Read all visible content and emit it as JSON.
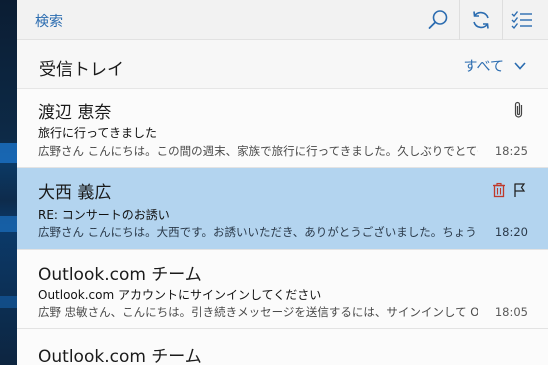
{
  "search": {
    "label": "検索"
  },
  "toolbar": {
    "icons": [
      "search-icon",
      "sync-icon",
      "select-mode-icon"
    ]
  },
  "folder": {
    "title": "受信トレイ",
    "filter_label": "すべて"
  },
  "colors": {
    "accent": "#2b6cb0",
    "selected_row": "#b3d4ef",
    "delete": "#c0392b"
  },
  "messages": [
    {
      "sender": "渡辺 恵奈",
      "subject": "旅行に行ってきました",
      "preview": "広野さん こんにちは。この間の週末、家族で旅行に行ってきました。久しぶりでとても楽",
      "time": "18:25",
      "icons": [
        "attachment-icon"
      ]
    },
    {
      "sender": "大西 義広",
      "subject": "RE: コンサートのお誘い",
      "preview": "広野さん こんにちは。大西です。お誘いいただき、ありがとうございました。ちょうどその日は",
      "time": "18:20",
      "icons": [
        "delete-icon",
        "flag-icon"
      ],
      "selected": true
    },
    {
      "sender": "Outlook.com チーム",
      "subject": "Outlook.com アカウントにサインインしてください",
      "preview": "広野 忠敏さん、こんにちは。引き続きメッセージを送信するには、サインインして Outlook",
      "time": "18:05",
      "icons": []
    },
    {
      "sender": "Outlook.com チーム",
      "subject": "",
      "preview": "",
      "time": "",
      "icons": []
    }
  ]
}
